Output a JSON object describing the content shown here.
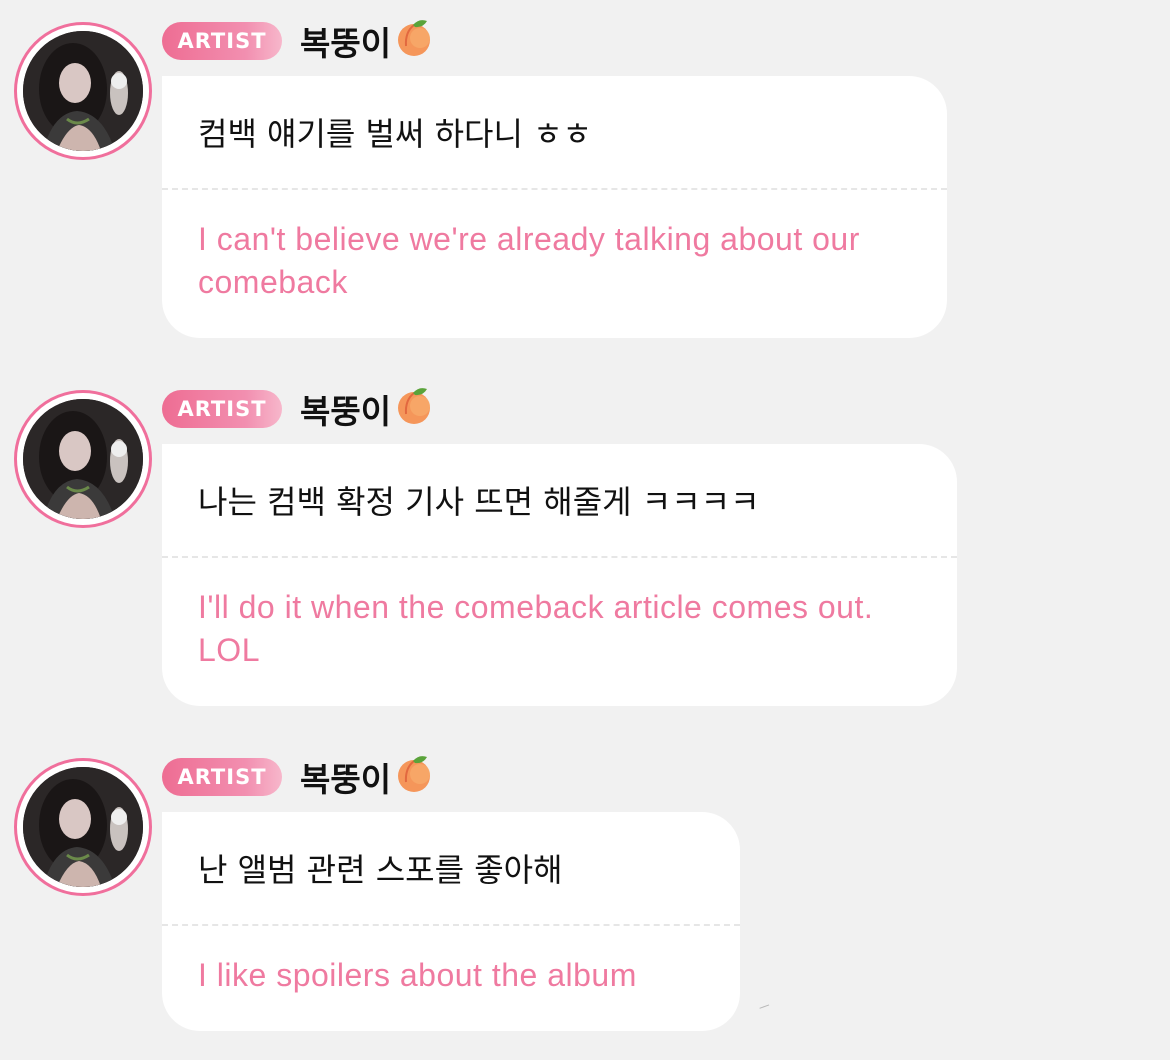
{
  "theme": {
    "accent": "#ef7aa0",
    "badge_color": "#ee6d93",
    "background": "#f1f1f1",
    "bubble": "#ffffff"
  },
  "messages": [
    {
      "badge": "ARTIST",
      "author": "복뚱이",
      "author_emoji": "peach-icon",
      "korean": "컴백 얘기를 벌써 하다니 ㅎㅎ",
      "english": "I can't believe we're already talking about our comeback"
    },
    {
      "badge": "ARTIST",
      "author": "복뚱이",
      "author_emoji": "peach-icon",
      "korean": "나는 컴백 확정 기사 뜨면 해줄게 ㅋㅋㅋㅋ",
      "english": "I'll do it when the comeback article comes out. LOL"
    },
    {
      "badge": "ARTIST",
      "author": "복뚱이",
      "author_emoji": "peach-icon",
      "korean": "난 앨범 관련 스포를 좋아해",
      "english": "I like spoilers about the album"
    }
  ]
}
